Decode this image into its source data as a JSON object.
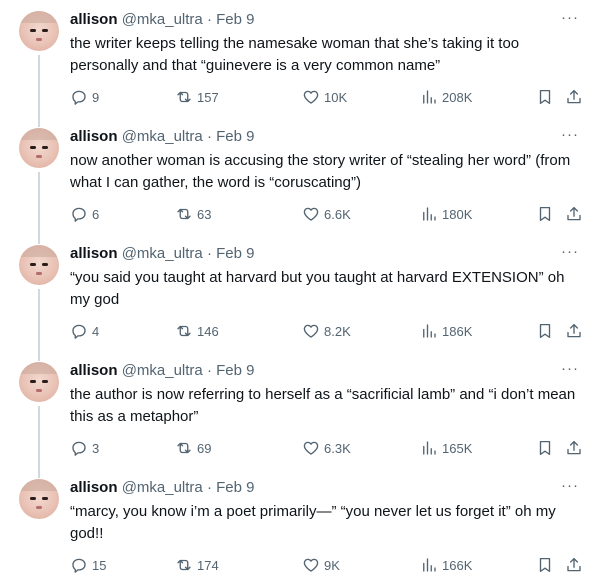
{
  "tweets": [
    {
      "name": "allison",
      "handle": "@mka_ultra",
      "separator": "·",
      "date": "Feb 9",
      "more": "···",
      "text": "the writer keeps telling the namesake woman that she’s taking it too personally and that “guinevere is a very common name”",
      "replies": "9",
      "retweets": "157",
      "likes": "10K",
      "views": "208K"
    },
    {
      "name": "allison",
      "handle": "@mka_ultra",
      "separator": "·",
      "date": "Feb 9",
      "more": "···",
      "text": "now another woman is accusing the story writer of “stealing her word” (from what I can gather, the word is “coruscating”)",
      "replies": "6",
      "retweets": "63",
      "likes": "6.6K",
      "views": "180K"
    },
    {
      "name": "allison",
      "handle": "@mka_ultra",
      "separator": "·",
      "date": "Feb 9",
      "more": "···",
      "text": "“you said you taught at harvard but you taught at harvard EXTENSION” oh my god",
      "replies": "4",
      "retweets": "146",
      "likes": "8.2K",
      "views": "186K"
    },
    {
      "name": "allison",
      "handle": "@mka_ultra",
      "separator": "·",
      "date": "Feb 9",
      "more": "···",
      "text": "the author is now referring to herself as a “sacrificial lamb” and “i don’t mean this as a metaphor”",
      "replies": "3",
      "retweets": "69",
      "likes": "6.3K",
      "views": "165K"
    },
    {
      "name": "allison",
      "handle": "@mka_ultra",
      "separator": "·",
      "date": "Feb 9",
      "more": "···",
      "text": "“marcy, you know i’m a poet primarily—” “you never let us forget it” oh my god!!",
      "replies": "15",
      "retweets": "174",
      "likes": "9K",
      "views": "166K"
    }
  ]
}
